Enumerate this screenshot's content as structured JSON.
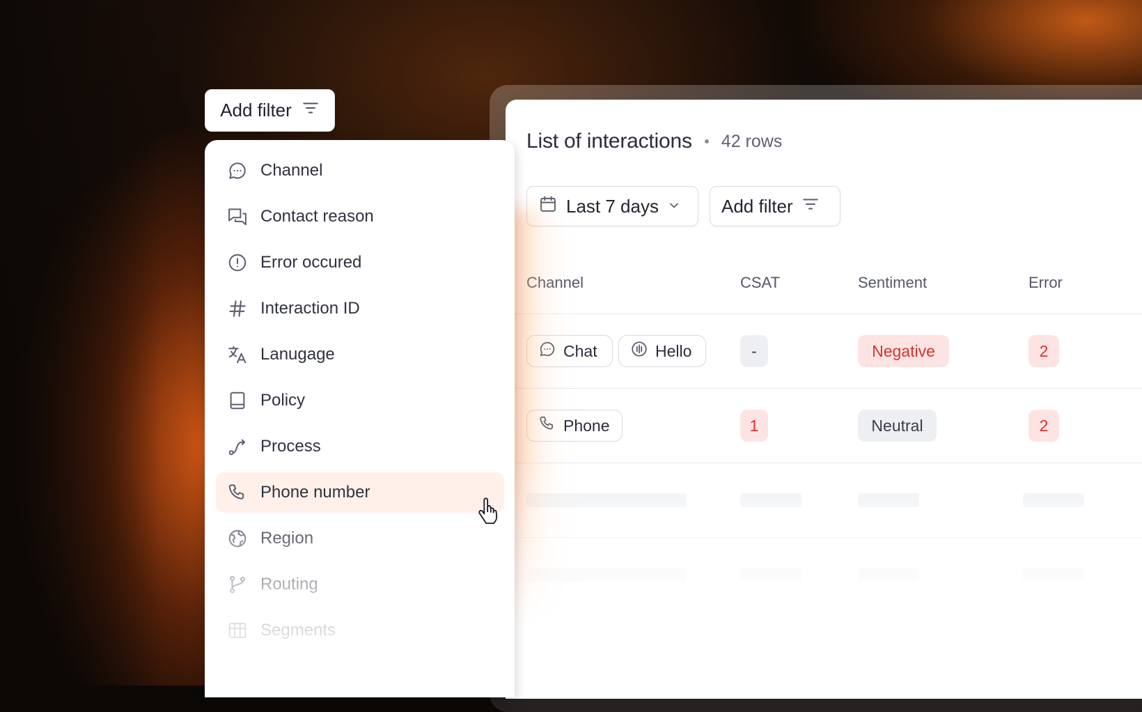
{
  "filter_menu": {
    "button_label": "Add filter",
    "items": [
      {
        "label": "Channel",
        "icon": "chat-bubble-icon"
      },
      {
        "label": "Contact reason",
        "icon": "messages-icon"
      },
      {
        "label": "Error occured",
        "icon": "alert-circle-icon"
      },
      {
        "label": "Interaction ID",
        "icon": "hash-icon"
      },
      {
        "label": "Lanugage",
        "icon": "translate-icon"
      },
      {
        "label": "Policy",
        "icon": "book-icon"
      },
      {
        "label": "Process",
        "icon": "route-icon"
      },
      {
        "label": "Phone number",
        "icon": "phone-icon"
      },
      {
        "label": "Region",
        "icon": "globe-icon"
      },
      {
        "label": "Routing",
        "icon": "git-branch-icon"
      },
      {
        "label": "Segments",
        "icon": "table-icon"
      }
    ],
    "hovered_item": "Phone number"
  },
  "panel": {
    "title": "List of interactions",
    "row_count": "42 rows",
    "date_filter": "Last 7 days",
    "add_filter_label": "Add filter",
    "columns": [
      "Channel",
      "CSAT",
      "Sentiment",
      "Error"
    ],
    "rows": [
      {
        "channels": [
          "Chat",
          "Hello"
        ],
        "csat": "-",
        "sentiment": "Negative",
        "error": "2"
      },
      {
        "channels": [
          "Phone"
        ],
        "csat": "1",
        "sentiment": "Neutral",
        "error": "2"
      }
    ]
  },
  "colors": {
    "accent_orange": "#e0601c",
    "negative_red": "#d7332f",
    "hover_bg": "#fff0ea"
  }
}
